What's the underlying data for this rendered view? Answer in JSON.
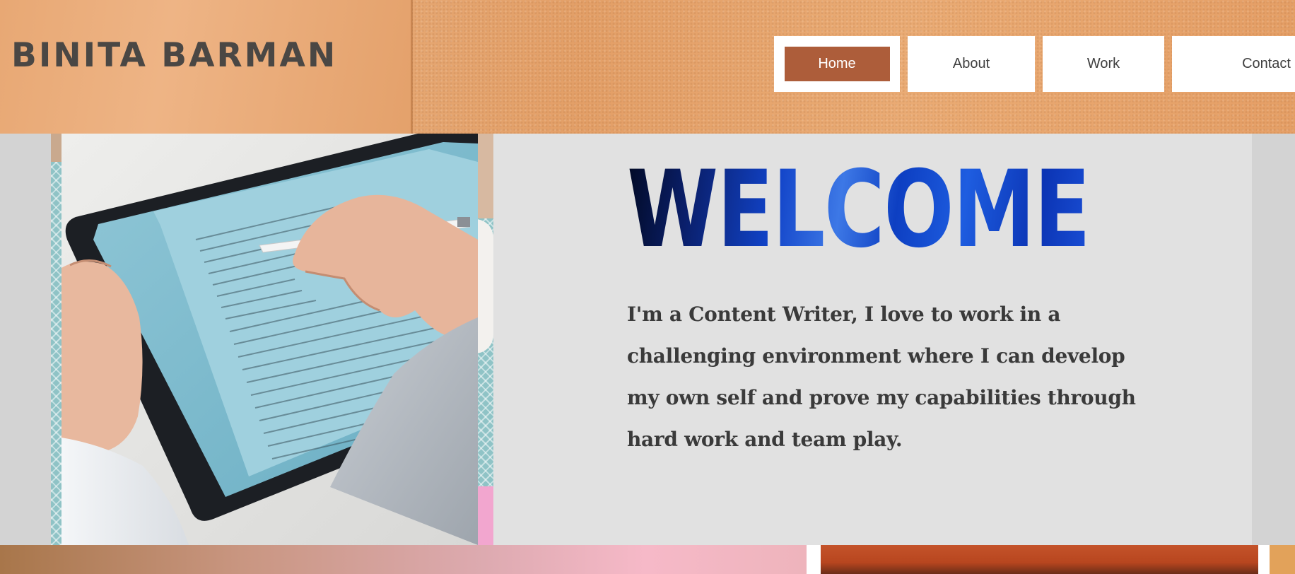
{
  "site": {
    "logo_text": "BINITA BARMAN"
  },
  "nav": {
    "items": [
      {
        "label": "Home",
        "active": true
      },
      {
        "label": "About",
        "active": false
      },
      {
        "label": "Work",
        "active": false
      },
      {
        "label": "Contact",
        "active": false
      }
    ]
  },
  "hero": {
    "heading": "WELCOME",
    "intro_lines": [
      "I'm a Content Writer, I love to work in a",
      "challenging environment where I can develop",
      "my own self and prove my capabilities through",
      "hard work and team play."
    ],
    "image_icon": "tablet-writing-photo"
  },
  "colors": {
    "nav_active": "#ad5d3a",
    "header_bg": "#e4a36c",
    "hero_panel": "#e1e1e1",
    "heading_blue": "#1143c8",
    "body_text": "#3a3a3a"
  }
}
